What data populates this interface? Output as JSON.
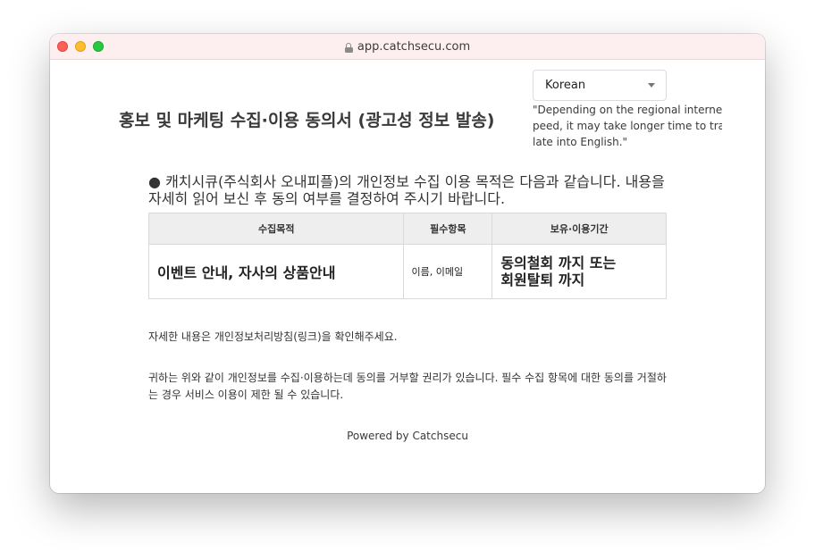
{
  "browser": {
    "url": "app.catchsecu.com"
  },
  "page": {
    "title": "홍보 및 마케팅 수집·이용 동의서 (광고성 정보 발송)",
    "language_select": {
      "selected": "Korean"
    },
    "translate_note_lines": [
      "\"Depending on the regional internet s",
      "peed, it may take longer time to trans",
      "late into English.\""
    ],
    "intro_bullet": "●",
    "intro_text": "캐치시큐(주식회사 오내피플)의 개인정보 수집 이용 목적은 다음과 같습니다. 내용을 자세히 읽어 보신 후 동의 여부를 결정하여 주시기 바랍니다.",
    "table": {
      "headers": [
        "수집목적",
        "필수항목",
        "보유·이용기간"
      ],
      "rows": [
        {
          "purpose": "이벤트 안내, 자사의 상품안내",
          "items": "이름, 이메일",
          "period_lines": [
            "동의철회 까지 또는",
            "회원탈퇴 까지"
          ]
        }
      ]
    },
    "detail_note": "자세한 내용은 개인정보처리방침(링크)을 확인해주세요.",
    "rights_note": "귀하는 위와 같이 개인정보를 수집·이용하는데 동의를 거부할 권리가 있습니다. 필수 수집 항목에 대한 동의를 거절하는 경우 서비스 이용이 제한 될 수 있습니다.",
    "footer": "Powered by Catchsecu"
  },
  "colors": {
    "titlebar": "#fdeff0",
    "table_header": "#eeeeee",
    "close": "#fe5f57",
    "minimize": "#febc2e",
    "zoom": "#28c840"
  }
}
